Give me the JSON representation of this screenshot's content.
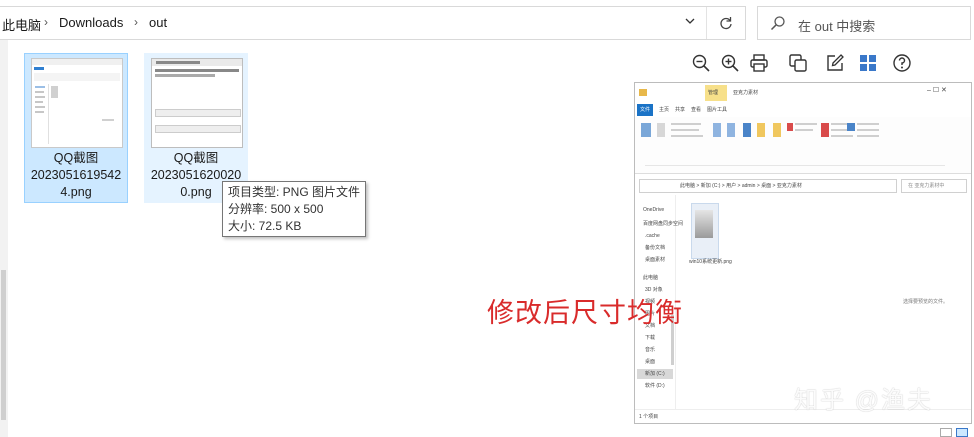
{
  "address_bar": {
    "crumbs": [
      "此电脑",
      "Downloads",
      "out"
    ]
  },
  "search": {
    "placeholder": "在 out 中搜索"
  },
  "files": [
    {
      "name_lines": [
        "QQ截图",
        "2023051619542",
        "4.png"
      ],
      "selected": true
    },
    {
      "name_lines": [
        "QQ截图",
        "2023051620020",
        "0.png"
      ],
      "selected": false
    }
  ],
  "tooltip": {
    "type": "项目类型: PNG 图片文件",
    "resolution": "分辨率: 500 x 500",
    "size": "大小: 72.5 KB"
  },
  "preview_toolbar": {
    "icons": [
      "zoom-out-icon",
      "zoom-in-icon",
      "print-icon",
      "copy-icon",
      "edit-icon",
      "grid-icon",
      "help-icon"
    ]
  },
  "preview_image": {
    "tabs": [
      "文件",
      "主页",
      "共享",
      "查看",
      "图片工具"
    ],
    "manage_tab": "管理",
    "folder_title": "亚克力素材",
    "path": "此电脑 > 新加 (C:) > 用户 > admin > 桌面 > 亚克力素材",
    "search_hint": "在 亚克力素材中",
    "nav_items": [
      "OneDrive",
      "百度网盘同步空间",
      ".cache",
      "备份文档",
      "桌面素材",
      "此电脑",
      "3D 对象",
      "视频",
      "图片",
      "文档",
      "下载",
      "音乐",
      "桌面",
      "新加 (C:)",
      "软件 (D:)"
    ],
    "file_label": "win10系统更新.png",
    "empty_hint": "选择要预览的文件。",
    "status": "1 个项目"
  },
  "annotation": "修改后尺寸均衡",
  "watermark": "知乎 @渔夫",
  "colors": {
    "selection_bg": "#cce8ff",
    "selection_border": "#99d1ff",
    "annotation_red": "#d92b2b",
    "accent_blue": "#1a73c6"
  }
}
